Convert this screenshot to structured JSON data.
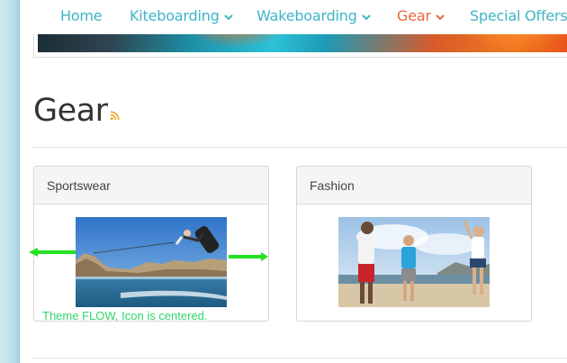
{
  "nav": {
    "items": [
      {
        "label": "Home",
        "dropdown": false,
        "active": false
      },
      {
        "label": "Kiteboarding",
        "dropdown": true,
        "active": false
      },
      {
        "label": "Wakeboarding",
        "dropdown": true,
        "active": false
      },
      {
        "label": "Gear",
        "dropdown": true,
        "active": true
      },
      {
        "label": "Special Offers",
        "dropdown": false,
        "active": false
      }
    ],
    "link_color": "#3eb4c8",
    "active_color": "#e8673f"
  },
  "page": {
    "title": "Gear",
    "rss_icon": "rss-icon",
    "rss_color": "#f0a21e"
  },
  "categories": [
    {
      "title": "Sportswear",
      "image": "wakeboarder-jump-photo"
    },
    {
      "title": "Fashion",
      "image": "people-walking-beach-photo"
    }
  ],
  "annotation": {
    "caption": "Theme FLOW, Icon is centered.",
    "color": "#23e123"
  }
}
